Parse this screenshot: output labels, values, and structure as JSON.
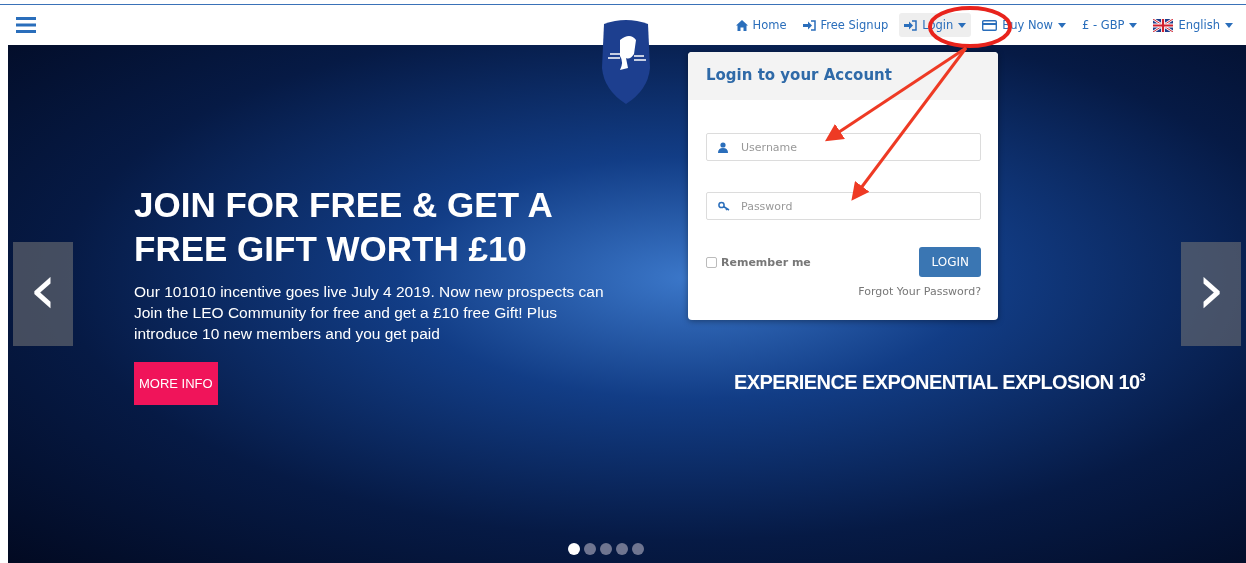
{
  "nav": {
    "items": [
      {
        "label": "Home",
        "kind": "home",
        "dropdown": false,
        "open": false
      },
      {
        "label": "Free Signup",
        "kind": "signin",
        "dropdown": false,
        "open": false
      },
      {
        "label": "Login",
        "kind": "signin",
        "dropdown": true,
        "open": true
      },
      {
        "label": "Buy Now",
        "kind": "card",
        "dropdown": true,
        "open": false
      },
      {
        "label": "£ - GBP",
        "kind": "plain",
        "dropdown": true,
        "open": false
      },
      {
        "label": "English",
        "kind": "flag",
        "dropdown": true,
        "open": false
      }
    ]
  },
  "login_panel": {
    "title": "Login to your Account",
    "username": {
      "placeholder": "Username"
    },
    "password": {
      "placeholder": "Password"
    },
    "remember": {
      "label": "Remember me",
      "checked": false
    },
    "button": "LOGIN",
    "forgot": "Forgot Your Password?"
  },
  "slide": {
    "heading": "JOIN FOR FREE & GET A FREE GIFT WORTH £10",
    "text": "Our 101010 incentive goes live July 4 2019. Now new prospects can Join the LEO Community for free and get a £10 free Gift! Plus introduce 10 new members and you get paid",
    "button": "MORE INFO",
    "tagline": "EXPERIENCE EXPONENTIAL EXPLOSION 10$^{3}$"
  },
  "carousel": {
    "prev": "‹",
    "next": "›",
    "dots": [
      {
        "selected": true
      },
      {
        "selected": false
      },
      {
        "selected": false
      },
      {
        "selected": false
      },
      {
        "selected": false
      }
    ]
  }
}
